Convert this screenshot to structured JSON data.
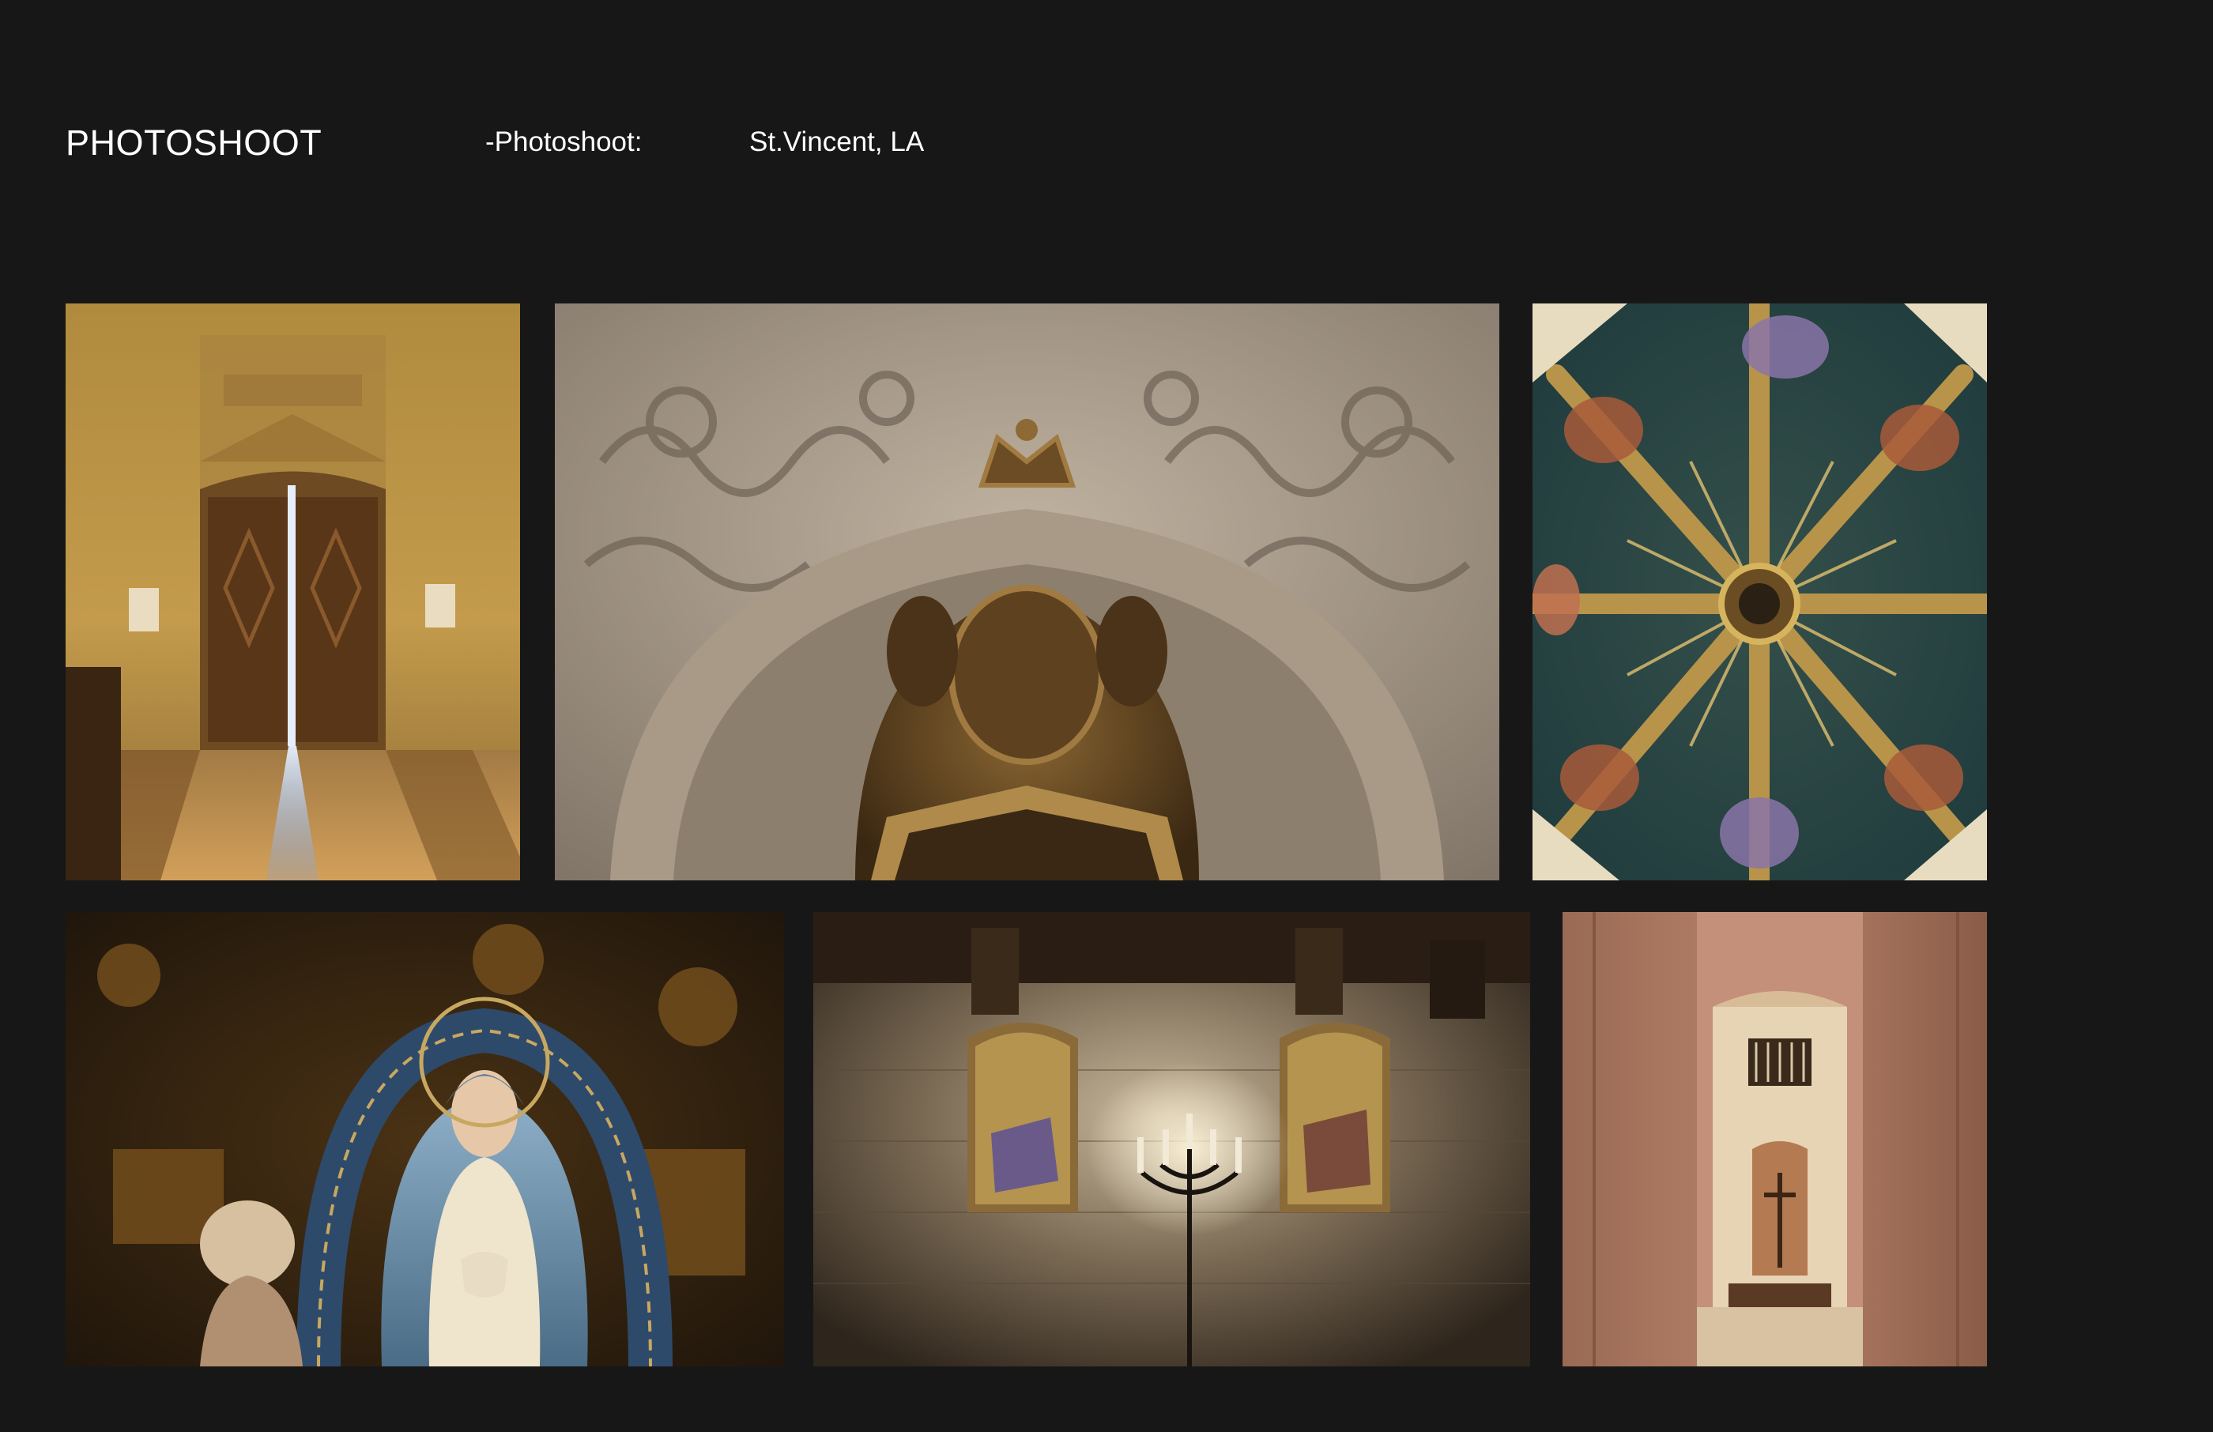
{
  "header": {
    "title": "PHOTOSHOOT",
    "label": "-Photoshoot:",
    "location": "St.Vincent, LA"
  },
  "gallery": {
    "photos": [
      {
        "subject": "church-doorway-light"
      },
      {
        "subject": "ornate-crest-carving"
      },
      {
        "subject": "painted-dome-ceiling"
      },
      {
        "subject": "madonna-statue"
      },
      {
        "subject": "candle-sconce-mosaics"
      },
      {
        "subject": "chapel-corridor-crucifix"
      }
    ]
  },
  "colors": {
    "background": "#181718",
    "text": "#ffffff"
  }
}
